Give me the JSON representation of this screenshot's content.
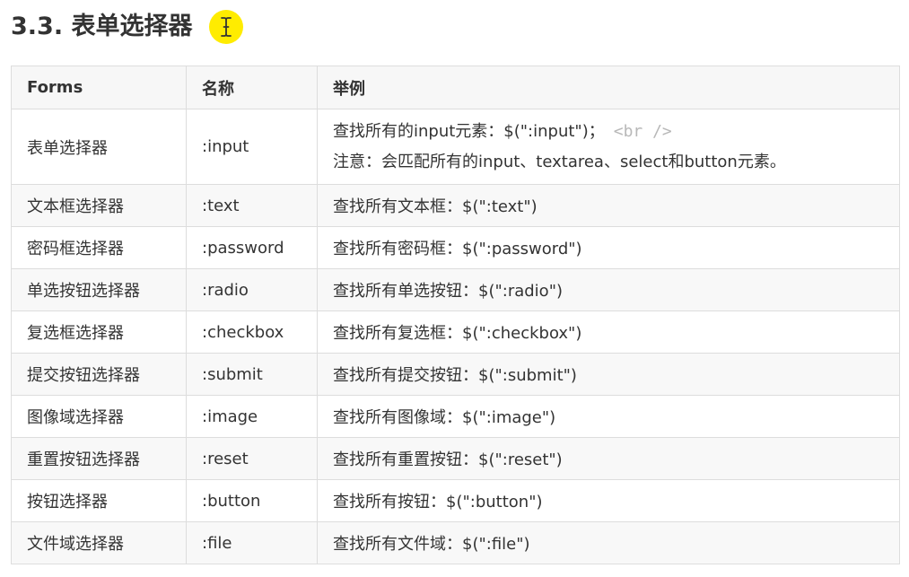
{
  "heading": "3.3. 表单选择器",
  "table": {
    "headers": [
      "Forms",
      "名称",
      "举例"
    ],
    "rows": [
      {
        "name": "表单选择器",
        "selector": ":input",
        "example": "查找所有的input元素：$(\":input\")；",
        "code": "<br />",
        "note": "注意：会匹配所有的input、textarea、select和button元素。"
      },
      {
        "name": "文本框选择器",
        "selector": ":text",
        "example": "查找所有文本框：$(\":text\")"
      },
      {
        "name": "密码框选择器",
        "selector": ":password",
        "example": "查找所有密码框：$(\":password\")"
      },
      {
        "name": "单选按钮选择器",
        "selector": ":radio",
        "example": "查找所有单选按钮：$(\":radio\")"
      },
      {
        "name": "复选框选择器",
        "selector": ":checkbox",
        "example": "查找所有复选框：$(\":checkbox\")"
      },
      {
        "name": "提交按钮选择器",
        "selector": ":submit",
        "example": "查找所有提交按钮：$(\":submit\")"
      },
      {
        "name": "图像域选择器",
        "selector": ":image",
        "example": "查找所有图像域：$(\":image\")"
      },
      {
        "name": "重置按钮选择器",
        "selector": ":reset",
        "example": "查找所有重置按钮：$(\":reset\")"
      },
      {
        "name": "按钮选择器",
        "selector": ":button",
        "example": "查找所有按钮：$(\":button\")"
      },
      {
        "name": "文件域选择器",
        "selector": ":file",
        "example": "查找所有文件域：$(\":file\")"
      }
    ]
  },
  "icons": {
    "cursor": "text-cursor-icon"
  },
  "colors": {
    "highlight": "#ffec00",
    "border": "#dddddd",
    "header_bg": "#f7f7f7",
    "code": "#b8b8b8"
  }
}
